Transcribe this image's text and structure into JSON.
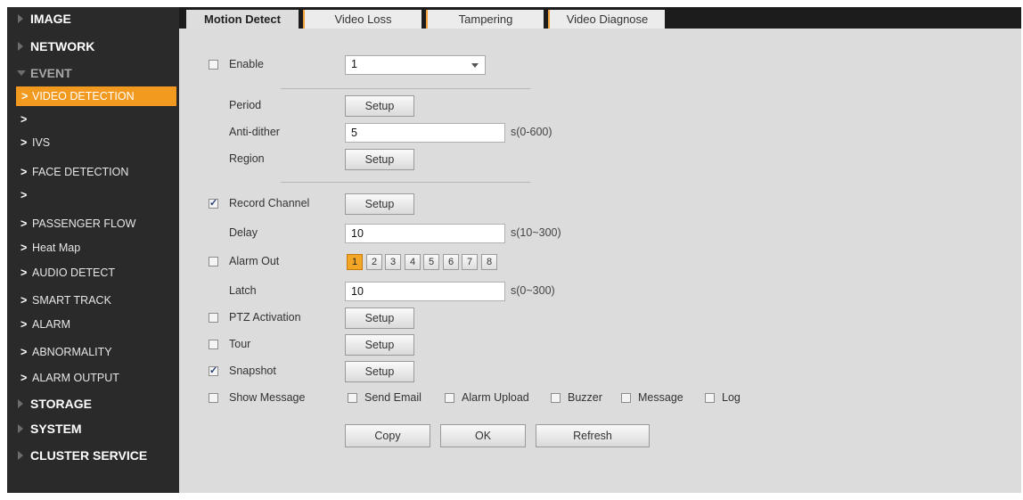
{
  "sidebar": {
    "image": "IMAGE",
    "network": "NETWORK",
    "event": "EVENT",
    "event_items": [
      {
        "label": "VIDEO DETECTION"
      },
      {
        "label": ""
      },
      {
        "label": "IVS"
      },
      {
        "label": "FACE DETECTION"
      },
      {
        "label": ""
      },
      {
        "label": "PASSENGER FLOW"
      },
      {
        "label": "Heat Map"
      },
      {
        "label": "AUDIO DETECT"
      },
      {
        "label": "SMART TRACK"
      },
      {
        "label": "ALARM"
      },
      {
        "label": "ABNORMALITY"
      },
      {
        "label": "ALARM OUTPUT"
      }
    ],
    "storage": "STORAGE",
    "system": "SYSTEM",
    "cluster": "CLUSTER SERVICE"
  },
  "tabs": [
    "Motion Detect",
    "Video Loss",
    "Tampering",
    "Video Diagnose"
  ],
  "form": {
    "enable_label": "Enable",
    "channel_value": "1",
    "period_label": "Period",
    "setup_label": "Setup",
    "antidither_label": "Anti-dither",
    "antidither_value": "5",
    "antidither_unit": "s(0-600)",
    "region_label": "Region",
    "record_channel_label": "Record Channel",
    "delay_label": "Delay",
    "delay_value": "10",
    "delay_unit": "s(10~300)",
    "alarm_out_label": "Alarm Out",
    "alarm_channels": [
      "1",
      "2",
      "3",
      "4",
      "5",
      "6",
      "7",
      "8"
    ],
    "latch_label": "Latch",
    "latch_value": "10",
    "latch_unit": "s(0~300)",
    "ptz_label": "PTZ Activation",
    "tour_label": "Tour",
    "snapshot_label": "Snapshot",
    "show_message_label": "Show Message",
    "send_email_label": "Send Email",
    "alarm_upload_label": "Alarm Upload",
    "buzzer_label": "Buzzer",
    "message_label": "Message",
    "log_label": "Log"
  },
  "buttons": {
    "copy": "Copy",
    "ok": "OK",
    "refresh": "Refresh"
  },
  "state": {
    "enable_checked": false,
    "record_channel_checked": true,
    "alarm_out_checked": false,
    "ptz_checked": false,
    "tour_checked": false,
    "snapshot_checked": true,
    "show_message_checked": false,
    "send_email_checked": false,
    "alarm_upload_checked": false,
    "buzzer_checked": false,
    "message_checked": false,
    "log_checked": false,
    "alarm_channel_selected": "1"
  },
  "colors": {
    "accent": "#f19a1f",
    "sidebar_bg": "#2a2a2a",
    "content_bg": "#dcdcdc"
  }
}
